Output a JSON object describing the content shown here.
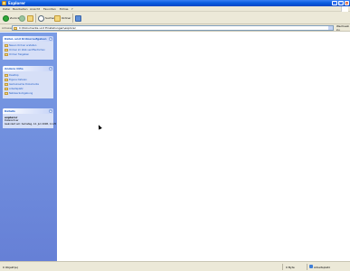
{
  "window": {
    "title": "Explorer",
    "buttons": {
      "minimize": "_",
      "maximize": "□",
      "close": "×"
    }
  },
  "menu": [
    "Datei",
    "Bearbeiten",
    "Ansicht",
    "Favoriten",
    "Extras",
    "?"
  ],
  "toolbar": {
    "back": "Zurück",
    "forward": "",
    "up": "",
    "search": "Suchen",
    "folders": "Ordner",
    "views": ""
  },
  "address": {
    "label": "Adresse",
    "value": "C:\\Dokumente und Einstellungen\\explorer",
    "go": "Wechseln zu"
  },
  "taskpane": {
    "file_tasks": {
      "title": "Datei- und Ordneraufgaben",
      "items": [
        "Neuen Ordner erstellen",
        "Ordner im Web veröffentlichen",
        "Ordner freigeben"
      ]
    },
    "other_places": {
      "title": "Andere Orte",
      "items": [
        "Desktop",
        "Eigene Dateien",
        "Gemeinsame Dokumente",
        "Arbeitsplatz",
        "Netzwerkumgebung"
      ]
    },
    "details": {
      "title": "Details",
      "name": "explorer",
      "type": "Dateiordner",
      "modified_label": "Geändert am: Samstag, 12. Juli 2008, 11:25"
    }
  },
  "status": {
    "left": "0 Objekt(e)",
    "size": "0 Byte",
    "zone": "Arbeitsplatz"
  },
  "colors": {
    "titlebar": "#0a5ee0",
    "taskpane": "#6680d6",
    "chrome": "#ece9d8"
  }
}
